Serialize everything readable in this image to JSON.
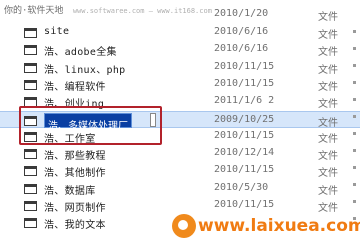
{
  "watermark_top": {
    "text": "你的·软件天地",
    "url": "www.softwaree.com — www.it168.com"
  },
  "rows": [
    {
      "name": "site",
      "date": "2010/6/16",
      "type": "文件"
    },
    {
      "name": "浩、adobe全集",
      "date": "2010/6/16",
      "type": "文件"
    },
    {
      "name": "浩、linux、php",
      "date": "2010/11/15",
      "type": "文件"
    },
    {
      "name": "浩、编程软件",
      "date": "2010/11/15",
      "type": "文件"
    },
    {
      "name": "浩、创业ing",
      "date": "2011/1/6 2",
      "type": "文件"
    },
    {
      "name": "浩、多媒体处理厂",
      "date": "2009/10/25",
      "type": "文件"
    },
    {
      "name": "浩、工作室",
      "date": "2010/11/15",
      "type": "文件"
    },
    {
      "name": "浩、那些教程",
      "date": "2010/12/14",
      "type": "文件"
    },
    {
      "name": "浩、其他制作",
      "date": "2010/11/15",
      "type": "文件"
    },
    {
      "name": "浩、数据库",
      "date": "2010/5/30",
      "type": "文件"
    },
    {
      "name": "浩、网页制作",
      "date": "2010/11/15",
      "type": "文件"
    },
    {
      "name": "浩、我的文本",
      "date": "",
      "type": ""
    }
  ],
  "partial_top_row": {
    "date": "2010/1/20",
    "type": "文件"
  },
  "selected_index": 5,
  "watermark_bottom": {
    "text": "www.laixuea.com"
  },
  "colors": {
    "selection_bg": "#d6e6fa",
    "rename_bg": "#0a3fa3",
    "highlight_outline": "#b2222b",
    "watermark_orange": "#f07b12"
  }
}
